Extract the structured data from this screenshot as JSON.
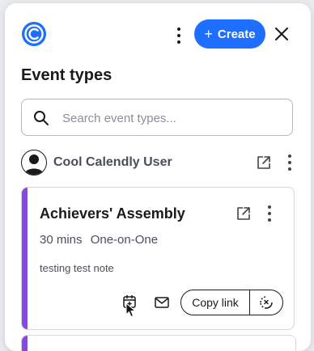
{
  "header": {
    "logo_icon": "calendly-logo",
    "more_icon": "vertical-dots-icon",
    "create_label": "Create",
    "create_icon": "plus-icon",
    "close_icon": "close-icon",
    "accent_color": "#1e6fff"
  },
  "page": {
    "title": "Event types"
  },
  "search": {
    "placeholder": "Search event types...",
    "value": ""
  },
  "user": {
    "name": "Cool Calendly User",
    "external_link_icon": "external-link-icon",
    "more_icon": "vertical-dots-icon"
  },
  "event_card": {
    "title": "Achievers' Assembly",
    "duration": "30 mins",
    "type": "One-on-One",
    "note": "testing test note",
    "accent_color": "#8a47e6",
    "actions": {
      "schedule_icon": "calendar-add-icon",
      "email_icon": "mail-icon",
      "copy_link_label": "Copy link",
      "extra_icon": "single-use-link-icon"
    }
  }
}
